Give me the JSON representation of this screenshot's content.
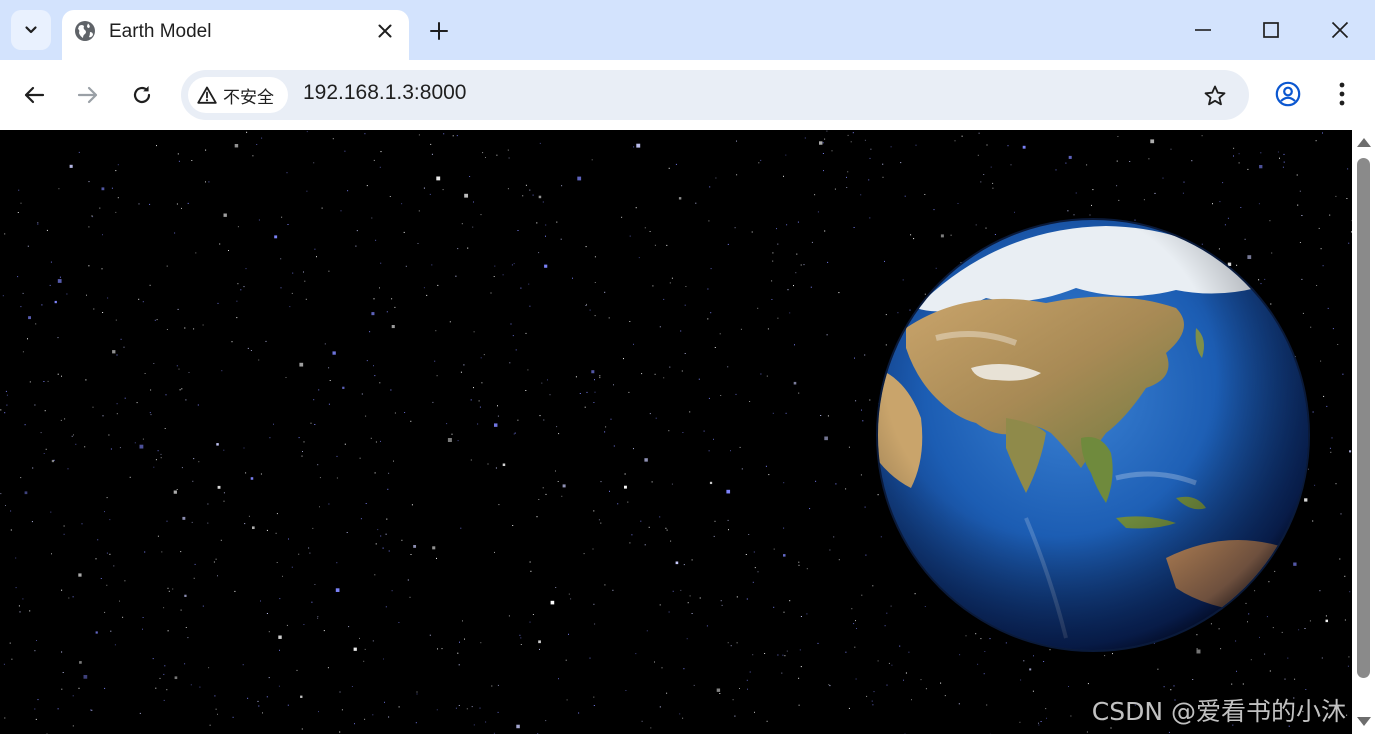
{
  "tab": {
    "title": "Earth Model"
  },
  "omnibox": {
    "security_label": "不安全",
    "url": "192.168.1.3:8000"
  },
  "watermark": "CSDN @爱看书的小沐",
  "icons": {
    "tab_search": "chevron-down-icon",
    "favicon": "globe-icon",
    "tab_close": "close-icon",
    "new_tab": "plus-icon",
    "minimize": "minimize-icon",
    "maximize": "maximize-icon",
    "close_window": "close-icon",
    "back": "arrow-left-icon",
    "forward": "arrow-right-icon",
    "reload": "reload-icon",
    "warning": "warning-icon",
    "bookmark": "star-icon",
    "profile": "account-circle-icon",
    "menu": "more-vertical-icon"
  },
  "colors": {
    "tabstrip": "#d3e3fd",
    "omnibox": "#e9eef6",
    "space": "#000000",
    "ocean": "#1f5fb8",
    "land": "#b59a63"
  },
  "navigation": {
    "can_go_back": true,
    "can_go_forward": false
  },
  "scrollbar": {
    "visible": true
  }
}
